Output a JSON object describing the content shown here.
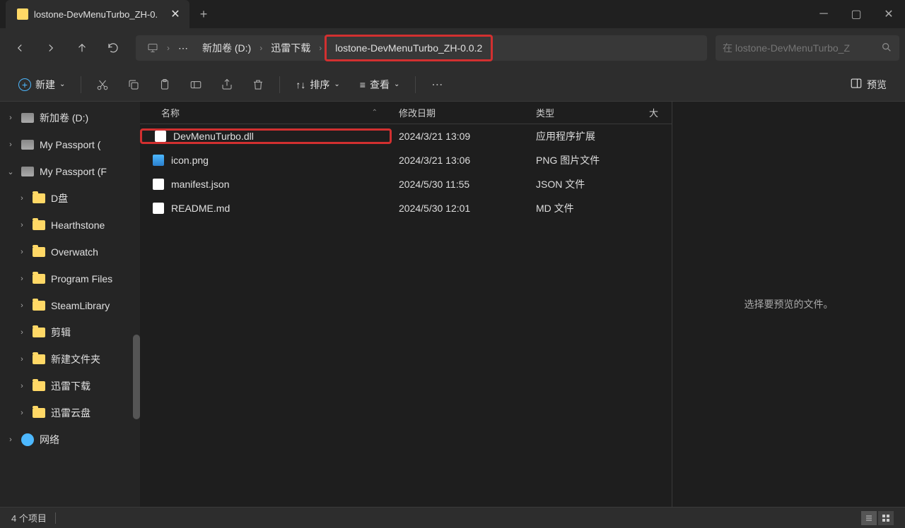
{
  "tab": {
    "title": "lostone-DevMenuTurbo_ZH-0."
  },
  "breadcrumb": {
    "items": [
      "新加卷 (D:)",
      "迅雷下载",
      "lostone-DevMenuTurbo_ZH-0.0.2"
    ],
    "ellipsis": "⋯"
  },
  "search": {
    "placeholder": "在 lostone-DevMenuTurbo_Z"
  },
  "toolbar": {
    "new_label": "新建",
    "sort_label": "排序",
    "view_label": "查看",
    "preview_label": "预览"
  },
  "columns": {
    "name": "名称",
    "date": "修改日期",
    "type": "类型",
    "size": "大"
  },
  "sidebar": {
    "items": [
      {
        "label": "新加卷 (D:)",
        "icon": "drive",
        "chev": "right",
        "indent": 0
      },
      {
        "label": "My Passport (",
        "icon": "drive",
        "chev": "right",
        "indent": 0
      },
      {
        "label": "My Passport (F",
        "icon": "drive",
        "chev": "down",
        "indent": 0
      },
      {
        "label": "D盘",
        "icon": "folder",
        "chev": "right",
        "indent": 1
      },
      {
        "label": "Hearthstone",
        "icon": "folder",
        "chev": "right",
        "indent": 1
      },
      {
        "label": "Overwatch",
        "icon": "folder",
        "chev": "right",
        "indent": 1
      },
      {
        "label": "Program Files",
        "icon": "folder",
        "chev": "right",
        "indent": 1
      },
      {
        "label": "SteamLibrary",
        "icon": "folder",
        "chev": "right",
        "indent": 1
      },
      {
        "label": "剪辑",
        "icon": "folder",
        "chev": "right",
        "indent": 1
      },
      {
        "label": "新建文件夹",
        "icon": "folder",
        "chev": "right",
        "indent": 1
      },
      {
        "label": "迅雷下载",
        "icon": "folder",
        "chev": "right",
        "indent": 1
      },
      {
        "label": "迅雷云盘",
        "icon": "folder",
        "chev": "right",
        "indent": 1
      },
      {
        "label": "网络",
        "icon": "network",
        "chev": "right",
        "indent": 0
      }
    ]
  },
  "files": [
    {
      "name": "DevMenuTurbo.dll",
      "date": "2024/3/21 13:09",
      "type": "应用程序扩展",
      "icon": "dll",
      "highlight": true
    },
    {
      "name": "icon.png",
      "date": "2024/3/21 13:06",
      "type": "PNG 图片文件",
      "icon": "png"
    },
    {
      "name": "manifest.json",
      "date": "2024/5/30 11:55",
      "type": "JSON 文件",
      "icon": "file"
    },
    {
      "name": "README.md",
      "date": "2024/5/30 12:01",
      "type": "MD 文件",
      "icon": "file"
    }
  ],
  "preview": {
    "empty_text": "选择要预览的文件。"
  },
  "status": {
    "count": "4 个项目"
  }
}
